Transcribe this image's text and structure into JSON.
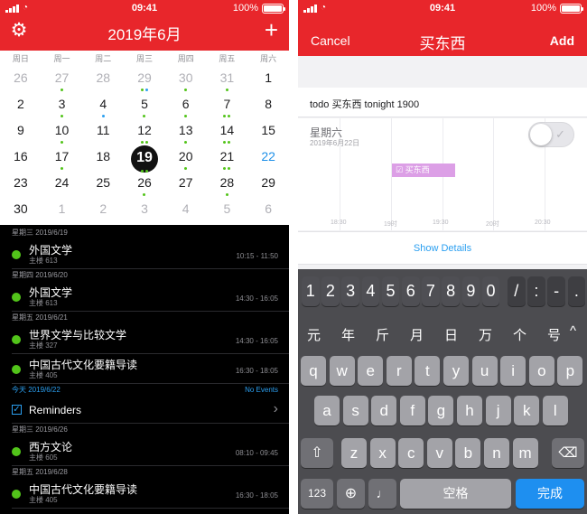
{
  "left": {
    "status": {
      "time": "09:41",
      "battery": "100%"
    },
    "header": {
      "title": "2019年6月"
    },
    "weekdays": [
      "周日",
      "周一",
      "周二",
      "周三",
      "周四",
      "周五",
      "周六"
    ],
    "weeks": [
      [
        {
          "d": "26",
          "dim": true
        },
        {
          "d": "27",
          "dim": true,
          "dots": "g"
        },
        {
          "d": "28",
          "dim": true
        },
        {
          "d": "29",
          "dim": true,
          "dots": "gb"
        },
        {
          "d": "30",
          "dim": true,
          "dots": "g"
        },
        {
          "d": "31",
          "dim": true,
          "dots": "g"
        },
        {
          "d": "1"
        }
      ],
      [
        {
          "d": "2"
        },
        {
          "d": "3",
          "dots": "g"
        },
        {
          "d": "4",
          "dots": "b"
        },
        {
          "d": "5",
          "dots": "g"
        },
        {
          "d": "6",
          "dots": "g"
        },
        {
          "d": "7",
          "dots": "gg"
        },
        {
          "d": "8"
        }
      ],
      [
        {
          "d": "9"
        },
        {
          "d": "10",
          "dots": "g"
        },
        {
          "d": "11"
        },
        {
          "d": "12",
          "dots": "gg"
        },
        {
          "d": "13",
          "dots": "g"
        },
        {
          "d": "14",
          "dots": "gg"
        },
        {
          "d": "15"
        }
      ],
      [
        {
          "d": "16"
        },
        {
          "d": "17",
          "dots": "g"
        },
        {
          "d": "18"
        },
        {
          "d": "19",
          "today": true,
          "dots": "gg"
        },
        {
          "d": "20",
          "dots": "g"
        },
        {
          "d": "21",
          "dots": "gg"
        },
        {
          "d": "22",
          "blue": true
        }
      ],
      [
        {
          "d": "23"
        },
        {
          "d": "24"
        },
        {
          "d": "25"
        },
        {
          "d": "26",
          "dots": "g"
        },
        {
          "d": "27"
        },
        {
          "d": "28",
          "dots": "g"
        },
        {
          "d": "29"
        }
      ],
      [
        {
          "d": "30"
        },
        {
          "d": "1",
          "dim": true
        },
        {
          "d": "2",
          "dim": true
        },
        {
          "d": "3",
          "dim": true
        },
        {
          "d": "4",
          "dim": true
        },
        {
          "d": "5",
          "dim": true
        },
        {
          "d": "6",
          "dim": true
        }
      ]
    ],
    "events": [
      {
        "kind": "section",
        "label": "星期三  2019/6/19"
      },
      {
        "kind": "event",
        "title": "外国文学",
        "sub": "主楼 613",
        "time": "10:15 - 11:50"
      },
      {
        "kind": "section",
        "label": "星期四  2019/6/20"
      },
      {
        "kind": "event",
        "title": "外国文学",
        "sub": "主楼 613",
        "time": "14:30 - 16:05"
      },
      {
        "kind": "section",
        "label": "星期五  2019/6/21"
      },
      {
        "kind": "event",
        "title": "世界文学与比较文学",
        "sub": "主楼 327",
        "time": "14:30 - 16:05"
      },
      {
        "kind": "event",
        "title": "中国古代文化要籍导读",
        "sub": "主楼 405",
        "time": "16:30 - 18:05"
      },
      {
        "kind": "today",
        "label": "今天  2019/6/22",
        "note": "No Events"
      },
      {
        "kind": "reminder",
        "title": "Reminders"
      },
      {
        "kind": "section",
        "label": "星期三  2019/6/26"
      },
      {
        "kind": "event",
        "title": "西方文论",
        "sub": "主楼 605",
        "time": "08:10 - 09:45"
      },
      {
        "kind": "section",
        "label": "星期五  2019/6/28"
      },
      {
        "kind": "event",
        "title": "中国古代文化要籍导读",
        "sub": "主楼 405",
        "time": "16:30 - 18:05"
      }
    ],
    "colors": {
      "accent": "#e8262b",
      "event_dot": "#52c41a",
      "link": "#2b9ff0"
    }
  },
  "right": {
    "status": {
      "time": "09:41",
      "battery": "100%"
    },
    "header": {
      "cancel": "Cancel",
      "title": "买东西",
      "add": "Add"
    },
    "entry_text": "todo 买东西 tonight 1900",
    "day": {
      "name": "星期六",
      "date": "2019年6月22日",
      "event_label": "买东西",
      "toggle_on": false
    },
    "timeline": [
      "18:30",
      "19时",
      "19:30",
      "20时",
      "20:30"
    ],
    "show_details": "Show Details",
    "keyboard": {
      "number_row": [
        "1",
        "2",
        "3",
        "4",
        "5",
        "6",
        "7",
        "8",
        "9",
        "0",
        "/",
        ":",
        "-",
        "."
      ],
      "candidates": [
        "元",
        "年",
        "斤",
        "月",
        "日",
        "万",
        "个",
        "号"
      ],
      "row1": [
        "q",
        "w",
        "e",
        "r",
        "t",
        "y",
        "u",
        "i",
        "o",
        "p"
      ],
      "row2": [
        "a",
        "s",
        "d",
        "f",
        "g",
        "h",
        "j",
        "k",
        "l"
      ],
      "row3": [
        "z",
        "x",
        "c",
        "v",
        "b",
        "n",
        "m"
      ],
      "mode_key": "123",
      "space": "空格",
      "done": "完成"
    }
  }
}
